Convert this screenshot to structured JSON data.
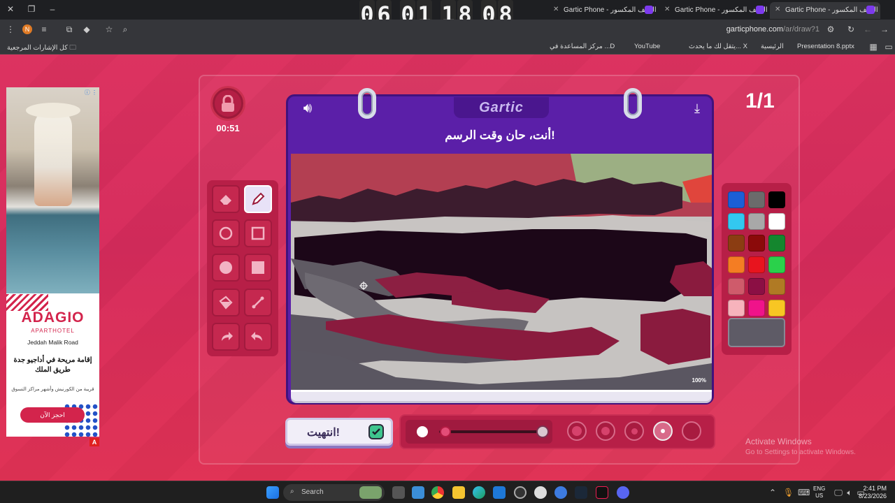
{
  "browser": {
    "timer_digits": [
      "0",
      "6",
      "0",
      "1",
      "1",
      "8",
      "0",
      "8"
    ],
    "tabs": [
      {
        "title": "Gartic Phone - الهاتف المكسور",
        "active": false
      },
      {
        "title": "Gartic Phone - الهاتف المكسور",
        "active": false
      },
      {
        "title": "Gartic Phone - الهاتف المكسور",
        "active": true
      }
    ],
    "url_host": "garticphone.com",
    "url_path": "/ar/draw?1",
    "bookmarks": {
      "all_bookmarks": "كل الإشارات المرجعية",
      "items": [
        "Presentation 8.pptx",
        "الرئيسية",
        "يتقل لك ما يحدث... X",
        "YouTube",
        "مركز المساعدة في ...D"
      ]
    }
  },
  "ad": {
    "brand": "ADAGIO",
    "sub": "APARTHOTEL",
    "location": "Jeddah Malik Road",
    "headline": "إقامة مريحة في أداجيو جدة طريق الملك",
    "tagline": "قريبة من الكورنيش وأشهر مراكز التسوق",
    "cta": "احجز الآن",
    "badge": "A"
  },
  "game": {
    "logo": "Gartic",
    "prompt": "أنت، حان وقت الرسم!",
    "countdown": "00:51",
    "rounds": "1/1",
    "zoom": "100%",
    "done_label": "انتهيت!",
    "selected_tool": "pen",
    "tools": [
      "eraser",
      "pen",
      "ellipse-outline",
      "rect-outline",
      "ellipse-fill",
      "rect-fill",
      "fill-bucket",
      "line",
      "undo",
      "redo"
    ],
    "palette": [
      "#1c5fd6",
      "#6b6b6b",
      "#000000",
      "#33c8f0",
      "#a8a8a8",
      "#ffffff",
      "#8b3d12",
      "#8b0a0a",
      "#14862e",
      "#f47d23",
      "#e8141e",
      "#2ad14b",
      "#cf5b6b",
      "#8b0f44",
      "#b07a24",
      "#f7b3bc",
      "#f0138a",
      "#f8c623"
    ],
    "current_color": "#5e5b66",
    "opacity_fraction": 0.05,
    "brush_sizes": 5,
    "selected_brush_index": 3
  },
  "watermark": {
    "line1": "Activate Windows",
    "line2": "Go to Settings to activate Windows."
  },
  "taskbar": {
    "search_placeholder": "Search",
    "lang_top": "ENG",
    "lang_bottom": "US",
    "time": "2:41 PM",
    "date": "8/23/2026"
  }
}
